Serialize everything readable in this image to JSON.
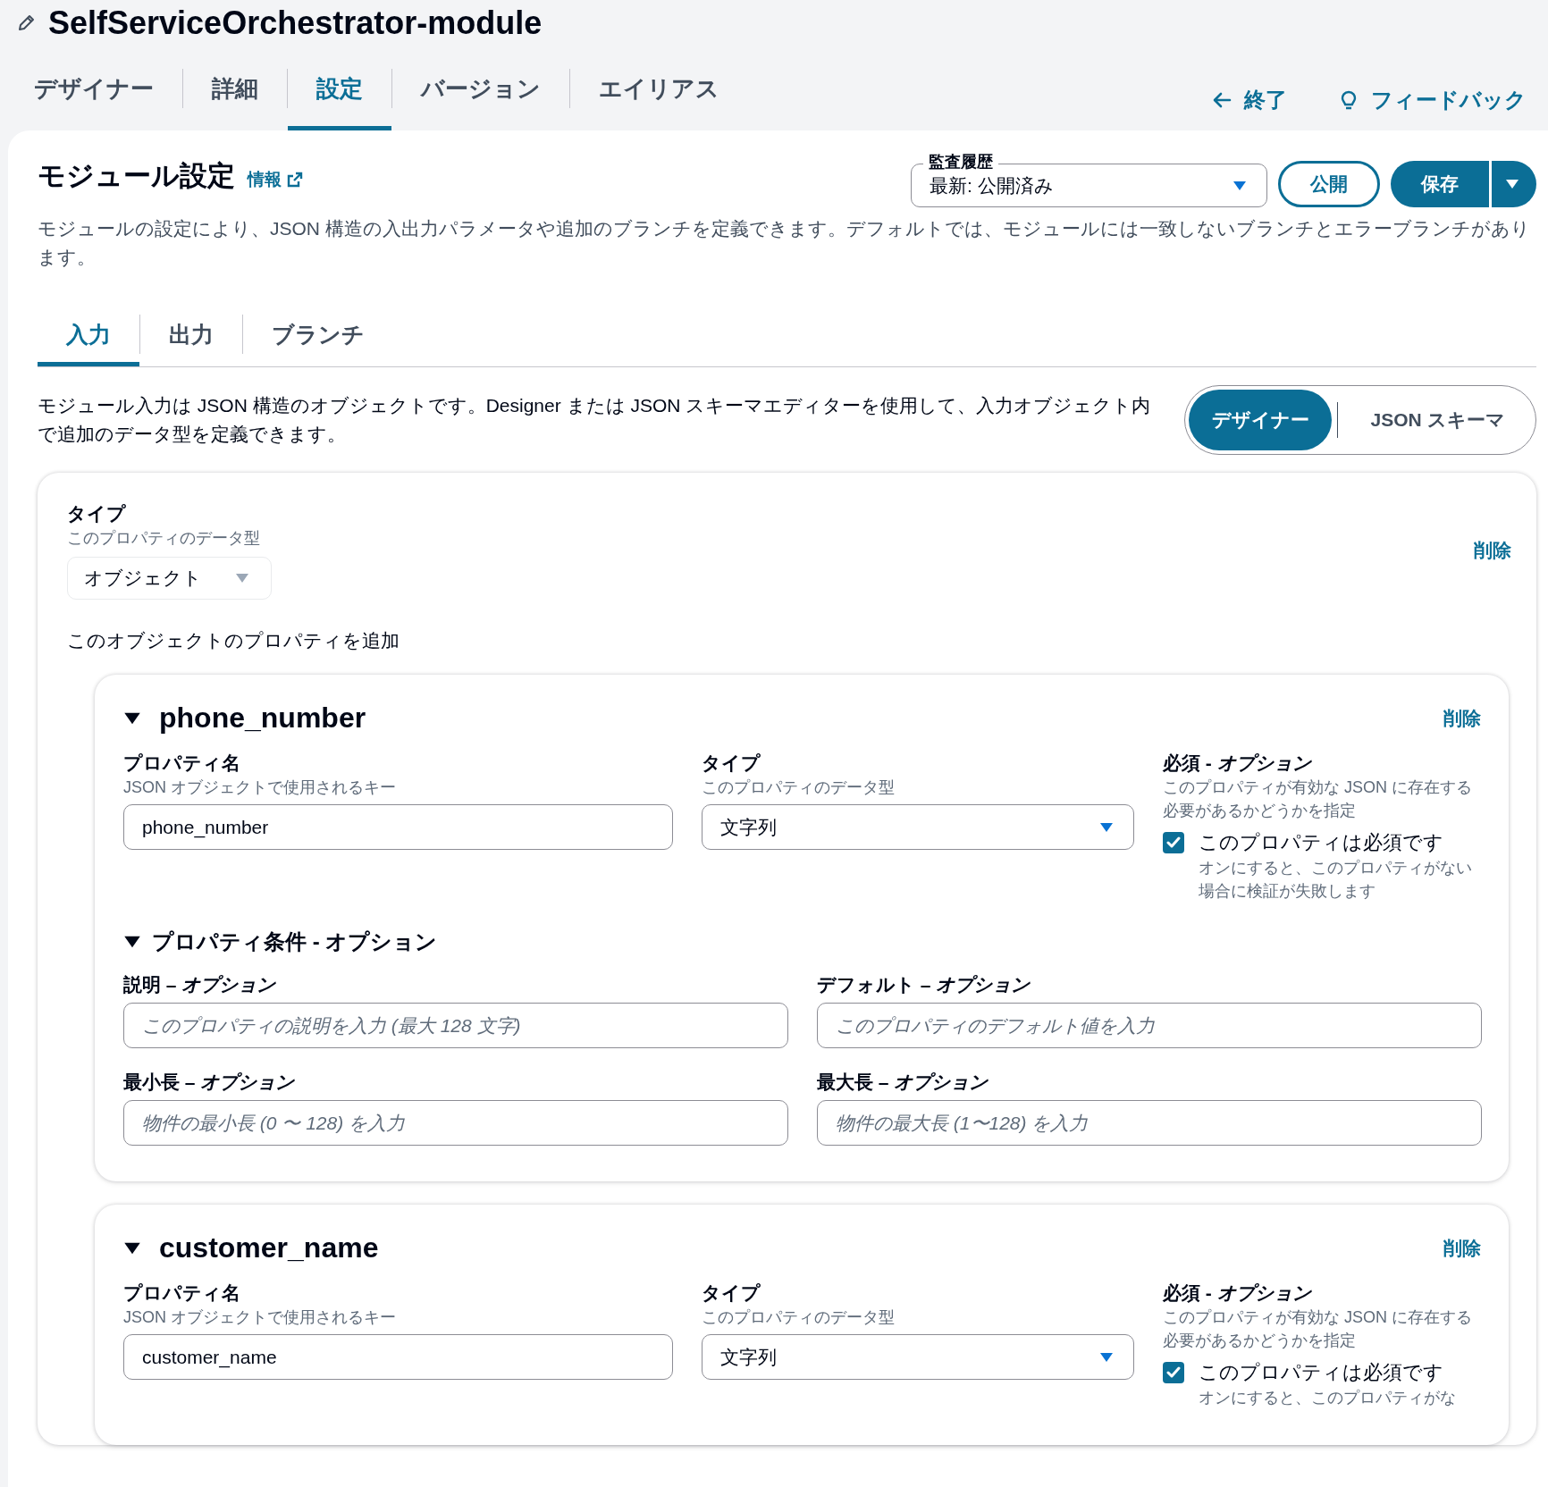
{
  "header": {
    "title": "SelfServiceOrchestrator-module"
  },
  "tabs": [
    {
      "label": "デザイナー",
      "selected": false
    },
    {
      "label": "詳細",
      "selected": false
    },
    {
      "label": "設定",
      "selected": true
    },
    {
      "label": "バージョン",
      "selected": false
    },
    {
      "label": "エイリアス",
      "selected": false
    }
  ],
  "header_links": [
    {
      "kind": "exit",
      "label": "終了"
    },
    {
      "kind": "feedback",
      "label": "フィードバック"
    }
  ],
  "settings": {
    "title": "モジュール設定",
    "info_link": "情報",
    "audit_label": "監査履歴",
    "audit_value": "最新: 公開済み",
    "publish_button": "公開",
    "save_button": "保存",
    "description": "モジュールの設定により、JSON 構造の入出力パラメータや追加のブランチを定義できます。デフォルトでは、モジュールには一致しないブランチとエラーブランチがあります。"
  },
  "sub_tabs": [
    {
      "label": "入力",
      "selected": true
    },
    {
      "label": "出力",
      "selected": false
    },
    {
      "label": "ブランチ",
      "selected": false
    }
  ],
  "input_description": "モジュール入力は JSON 構造のオブジェクトです。Designer または JSON スキーマエディターを使用して、入力オブジェクト内で追加のデータ型を定義できます。",
  "view_toggle": [
    {
      "label": "デザイナー",
      "selected": true
    },
    {
      "label": "JSON スキーマ",
      "selected": false
    }
  ],
  "root": {
    "type_label": "タイプ",
    "type_hint": "このプロパティのデータ型",
    "type_value": "オブジェクト",
    "disabled": true,
    "delete": "削除",
    "add_label": "このオブジェクトのプロパティを追加"
  },
  "properties": [
    {
      "name": "phone_number",
      "expanded": true,
      "delete": "削除",
      "name_label": "プロパティ名",
      "name_hint": "JSON オブジェクトで使用されるキー",
      "name_value": "phone_number",
      "type_label": "タイプ",
      "type_hint": "このプロパティのデータ型",
      "type_value": "文字列",
      "required_label": "必須 - *オプション*",
      "required_hint": "このプロパティが有効な JSON に存在する必要があるかどうかを指定",
      "required_checkbox": {
        "label": "このプロパティは必須です",
        "hint": "オンにすると、このプロパティがない場合に検証が失敗します",
        "checked": true
      },
      "conditions": {
        "title": "プロパティ条件 - オプション",
        "expanded": true,
        "fields": [
          {
            "label": "説明 – *オプション*",
            "placeholder": "このプロパティの説明を入力 (最大 128 文字)"
          },
          {
            "label": "デフォルト – *オプション*",
            "placeholder": "このプロパティのデフォルト値を入力"
          },
          {
            "label": "最小長 – *オプション*",
            "placeholder": "物件の最小長 (0 〜 128) を入力"
          },
          {
            "label": "最大長 – *オプション*",
            "placeholder": "物件の最大長 (1〜128) を入力"
          }
        ]
      }
    },
    {
      "name": "customer_name",
      "expanded": true,
      "delete": "削除",
      "name_label": "プロパティ名",
      "name_hint": "JSON オブジェクトで使用されるキー",
      "name_value": "customer_name",
      "type_label": "タイプ",
      "type_hint": "このプロパティのデータ型",
      "type_value": "文字列",
      "required_label": "必須 - *オプション*",
      "required_hint": "このプロパティが有効な JSON に存在する必要があるかどうかを指定",
      "required_checkbox": {
        "label": "このプロパティは必須です",
        "hint": "オンにすると、このプロパティがな",
        "checked": true
      }
    }
  ]
}
